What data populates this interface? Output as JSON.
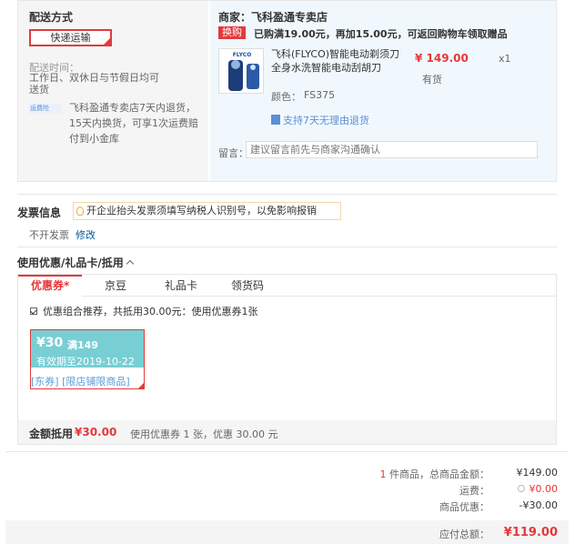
{
  "shipping": {
    "title": "配送方式",
    "method_button": "快递运输",
    "time_label": "配送时间：",
    "time_value": "工作日、双休日与节假日均可送货",
    "yunfeixian_badge": "运费险",
    "return_text": "飞科盈通专卖店7天内退货，15天内换货，可享1次运费赔付到小金库"
  },
  "shop": {
    "name": "商家：飞科盈通专卖店",
    "swap_badge": "换购",
    "promo_text": "已购满19.00元，再加15.00元，可返回购物车领取赠品"
  },
  "product": {
    "name": "飞科(FLYCO)智能电动剃须刀全身水洗智能电动刮胡刀",
    "price": "¥ 149.00",
    "qty": "x1",
    "stock": "有货",
    "color_label": "颜色：",
    "color_value": "FS375",
    "support": "支持7天无理由退货",
    "image_brand": "FLYCO"
  },
  "message": {
    "label": "留言：",
    "placeholder": "建议留言前先与商家沟通确认"
  },
  "invoice": {
    "title": "发票信息",
    "tip": "开企业抬头发票须填写纳税人识别号，以免影响报销",
    "status": "不开发票",
    "edit": "修改"
  },
  "discount": {
    "title": "使用优惠/礼品卡/抵用",
    "tabs": [
      {
        "label": "优惠券*",
        "active": true
      },
      {
        "label": "京豆",
        "active": false
      },
      {
        "label": "礼品卡",
        "active": false
      },
      {
        "label": "领货码",
        "active": false
      }
    ],
    "combo_text": "优惠组合推荐，共抵用30.00元：使用优惠券1张",
    "coupon": {
      "amount": "¥30",
      "condition": "满149",
      "valid": "有效期至2019-10-22",
      "tag": "[东券] [限店铺限商品]"
    },
    "footer_label": "金额抵用",
    "footer_amount": "¥30.00",
    "footer_desc": "使用优惠券 1 张，优惠 30.00 元"
  },
  "summary": {
    "count": "1",
    "count_label": "件商品，总商品金额：",
    "goods_total": "¥149.00",
    "shipping_label": "运费：",
    "shipping_value": "¥0.00",
    "discount_label": "商品优惠：",
    "discount_value": "-¥30.00",
    "payable_label": "应付总额：",
    "payable_value": "¥119.00"
  },
  "colors": {
    "accent_red": "#e4393c",
    "link_blue": "#005aa0",
    "coupon_teal": "#77cfd4"
  }
}
